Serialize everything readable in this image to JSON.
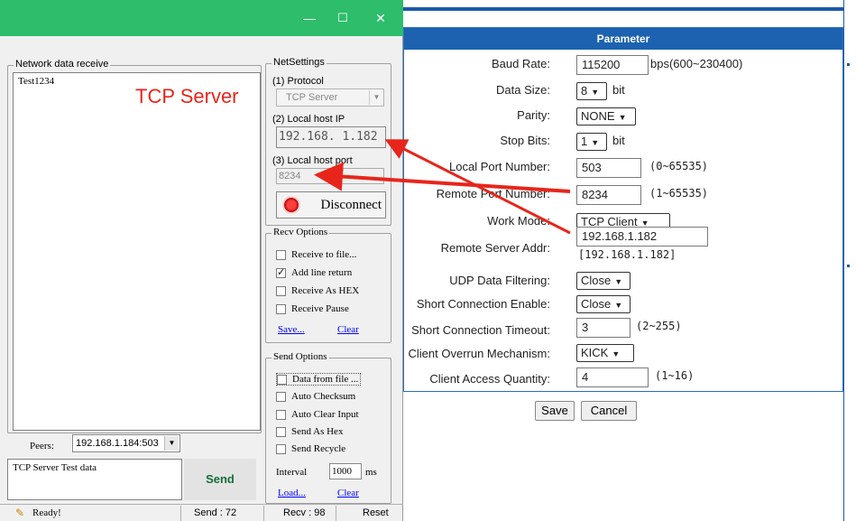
{
  "titlebar": {
    "minimize": "—",
    "maximize": "☐",
    "close": "✕"
  },
  "receive": {
    "group_label": "Network data receive",
    "content": "Test1234"
  },
  "overlay_label": "TCP Server",
  "netsettings": {
    "group_label": "NetSettings",
    "protocol_label": "(1) Protocol",
    "protocol_value": "TCP Server",
    "host_ip_label": "(2) Local host IP",
    "host_ip": [
      "192",
      ".168",
      ".  1",
      ".182"
    ],
    "host_port_label": "(3) Local host port",
    "host_port": "8234",
    "disconnect_label": "Disconnect"
  },
  "recv_options": {
    "group_label": "Recv Options",
    "items": [
      {
        "label": "Receive to file...",
        "checked": false
      },
      {
        "label": "Add line return",
        "checked": true
      },
      {
        "label": "Receive As HEX",
        "checked": false
      },
      {
        "label": "Receive Pause",
        "checked": false
      }
    ],
    "save": "Save...",
    "clear": "Clear"
  },
  "send_options": {
    "group_label": "Send Options",
    "items": [
      {
        "label": "Data from file ...",
        "checked": false
      },
      {
        "label": "Auto Checksum",
        "checked": false
      },
      {
        "label": "Auto Clear Input",
        "checked": false
      },
      {
        "label": "Send As Hex",
        "checked": false
      },
      {
        "label": "Send Recycle",
        "checked": false
      }
    ],
    "interval_label": "Interval",
    "interval_value": "1000",
    "interval_unit": "ms",
    "load": "Load...",
    "clear": "Clear"
  },
  "peers": {
    "label": "Peers:",
    "value": "192.168.1.184:503"
  },
  "send": {
    "text": "TCP Server Test data",
    "button": "Send"
  },
  "status": {
    "ready": "Ready!",
    "send": "Send : 72",
    "recv": "Recv : 98",
    "reset": "Reset"
  },
  "parameter": {
    "title": "Parameter",
    "baud_label": "Baud Rate:",
    "baud_value": "115200",
    "baud_unit": "bps(600~230400)",
    "datasize_label": "Data Size:",
    "datasize_value": "8",
    "datasize_unit": "bit",
    "parity_label": "Parity:",
    "parity_value": "NONE",
    "stopbits_label": "Stop Bits:",
    "stopbits_value": "1",
    "stopbits_unit": "bit",
    "localport_label": "Local Port Number:",
    "localport_value": "503",
    "localport_range": "(0~65535)",
    "remoteport_label": "Remote Port Number:",
    "remoteport_value": "8234",
    "remoteport_range": "(1~65535)",
    "workmode_label": "Work Mode:",
    "workmode_value": "TCP Client",
    "remoteaddr_label": "Remote Server Addr:",
    "remoteaddr_value": "192.168.1.182",
    "remoteaddr_hint": "[192.168.1.182]",
    "udpfilter_label": "UDP Data Filtering:",
    "udpfilter_value": "Close",
    "shortconn_label": "Short Connection Enable:",
    "shortconn_value": "Close",
    "shorttimeout_label": "Short Connection Timeout:",
    "shorttimeout_value": "3",
    "shorttimeout_range": "(2~255)",
    "overrun_label": "Client Overrun Mechanism:",
    "overrun_value": "KICK",
    "access_label": "Client Access Quantity:",
    "access_value": "4",
    "access_range": "(1~16)",
    "save_button": "Save",
    "cancel_button": "Cancel"
  },
  "colors": {
    "titlebar": "#2ebd6b",
    "panel_header": "#1c62b0",
    "annotation": "#e8251b",
    "link": "#0000ff"
  }
}
